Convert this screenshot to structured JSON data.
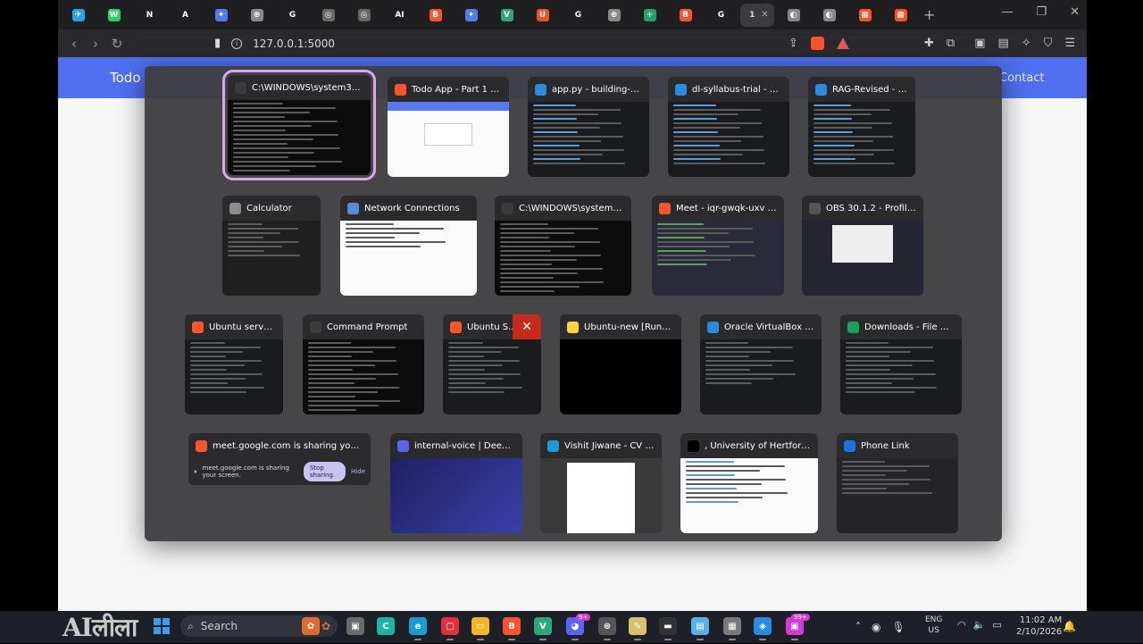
{
  "browser": {
    "tabs": [
      {
        "icon": "telegram-icon",
        "glyph": "✈",
        "color": "#2aa3e0"
      },
      {
        "icon": "whatsapp-icon",
        "glyph": "W",
        "color": "#25d366"
      },
      {
        "icon": "notion-icon",
        "glyph": "N",
        "color": "#ffffff",
        "dark": true
      },
      {
        "icon": "anthropic-icon",
        "glyph": "A",
        "color": "#ffffff",
        "dark": true
      },
      {
        "icon": "gemini-icon",
        "glyph": "✦",
        "color": "#4f7cf0"
      },
      {
        "icon": "openai-icon",
        "glyph": "⊛",
        "color": "#888888"
      },
      {
        "icon": "google-icon",
        "glyph": "G",
        "color": "#ffffff",
        "dark": true
      },
      {
        "icon": "github-icon",
        "glyph": "◎",
        "color": "#666666"
      },
      {
        "icon": "github-icon",
        "glyph": "◎",
        "color": "#666666"
      },
      {
        "icon": "ai-icon",
        "glyph": "AI",
        "color": "#ffffff",
        "dark": true
      },
      {
        "icon": "brave-icon",
        "glyph": "B",
        "color": "#fb542b"
      },
      {
        "icon": "gemini-icon",
        "glyph": "✦",
        "color": "#4f7cf0"
      },
      {
        "icon": "vscode-icon",
        "glyph": "V",
        "color": "#2aa87a"
      },
      {
        "icon": "ubuntu-icon",
        "glyph": "U",
        "color": "#e95420"
      },
      {
        "icon": "google-icon",
        "glyph": "G",
        "color": "#ffffff",
        "dark": true
      },
      {
        "icon": "openai-icon",
        "glyph": "⊛",
        "color": "#888888"
      },
      {
        "icon": "sheets-icon",
        "glyph": "+",
        "color": "#21a366"
      },
      {
        "icon": "brave-icon",
        "glyph": "B",
        "color": "#fb542b"
      },
      {
        "icon": "google-icon",
        "glyph": "G",
        "color": "#ffffff",
        "dark": true
      },
      {
        "icon": "active-tab-icon",
        "glyph": "1",
        "color": "#3a3a3f",
        "active": true
      },
      {
        "icon": "globe-icon",
        "glyph": "◐",
        "color": "#888888"
      },
      {
        "icon": "globe-icon",
        "glyph": "◐",
        "color": "#888888"
      },
      {
        "icon": "windows-icon",
        "glyph": "▦",
        "color": "#f35325"
      },
      {
        "icon": "windows-icon",
        "glyph": "▦",
        "color": "#f35325"
      }
    ],
    "url": "127.0.0.1:5000"
  },
  "page": {
    "brand": "Todo",
    "nav_contact": "Contact"
  },
  "switcher": {
    "rows": [
      [
        {
          "title": "C:\\WINDOWS\\system32\\...",
          "icon": "terminal-icon",
          "iconColor": "#3b3b3b",
          "thumb": "terminal",
          "selected": true
        },
        {
          "title": "Todo App - Part 1 - B...",
          "icon": "brave-icon",
          "iconColor": "#fb542b",
          "thumb": "web"
        },
        {
          "title": "app.py - building-a-t...",
          "icon": "vscode-icon",
          "iconColor": "#2b8be0",
          "thumb": "code"
        },
        {
          "title": "dl-syllabus-trial - Vis...",
          "icon": "vscode-icon",
          "iconColor": "#2b8be0",
          "thumb": "code"
        },
        {
          "title": "RAG-Revised - Vi...",
          "icon": "vscode-icon",
          "iconColor": "#2b8be0",
          "thumb": "code"
        }
      ],
      [
        {
          "title": "Calculator",
          "icon": "calculator-icon",
          "iconColor": "#8c8c8c",
          "thumb": "calc"
        },
        {
          "title": "Network Connections",
          "icon": "network-icon",
          "iconColor": "#5a8bd6",
          "thumb": "light"
        },
        {
          "title": "C:\\WINDOWS\\system32\\...",
          "icon": "terminal-icon",
          "iconColor": "#3b3b3b",
          "thumb": "terminal"
        },
        {
          "title": "Meet - iqr-gwqk-uxv -...",
          "icon": "brave-icon",
          "iconColor": "#fb542b",
          "thumb": "meet"
        },
        {
          "title": "OBS 30.1.2 - Profile:...",
          "icon": "obs-icon",
          "iconColor": "#555555",
          "thumb": "obs"
        }
      ],
      [
        {
          "title": "Ubuntu server...",
          "icon": "brave-icon",
          "iconColor": "#fb542b",
          "thumb": "dark"
        },
        {
          "title": "Command Prompt",
          "icon": "terminal-icon",
          "iconColor": "#3b3b3b",
          "thumb": "terminal"
        },
        {
          "title": "Ubuntu S...",
          "icon": "brave-icon",
          "iconColor": "#fb542b",
          "thumb": "dark",
          "close": true
        },
        {
          "title": "Ubuntu-new [Runnin...",
          "icon": "virtualbox-icon",
          "iconColor": "#ffd33d",
          "thumb": "black"
        },
        {
          "title": "Oracle VirtualBox Ma...",
          "icon": "virtualbox-icon",
          "iconColor": "#2b8be0",
          "thumb": "vbox"
        },
        {
          "title": "Downloads - File Exp...",
          "icon": "folder-icon",
          "iconColor": "#1e9e5a",
          "thumb": "explorer"
        }
      ],
      [
        {
          "title": "meet.google.com is sharing your scr...",
          "icon": "brave-icon",
          "iconColor": "#fb542b",
          "thumb": "share"
        },
        {
          "title": "internal-voice | Deep Le...",
          "icon": "discord-icon",
          "iconColor": "#5865f2",
          "thumb": "discord"
        },
        {
          "title": "Vishit Jiwane - CV .p...",
          "icon": "edge-icon",
          "iconColor": "#1a9bd7",
          "thumb": "doc"
        },
        {
          "title": ", University of Hertfordsh...",
          "icon": "black-square-icon",
          "iconColor": "#000000",
          "thumb": "uni"
        },
        {
          "title": "Phone Link",
          "icon": "phonelink-icon",
          "iconColor": "#1a73e8",
          "thumb": "phone"
        }
      ]
    ],
    "share_text": "meet.google.com is sharing your screen.",
    "stop_sharing": "Stop sharing",
    "hide": "Hide",
    "close_glyph": "✕"
  },
  "taskbar": {
    "watermark": "AIलीला",
    "search_placeholder": "Search",
    "badges": [
      "9+",
      "99+"
    ],
    "lang_top": "ENG",
    "lang_bottom": "US",
    "time": "11:02 AM",
    "date": "2/10/2026"
  }
}
